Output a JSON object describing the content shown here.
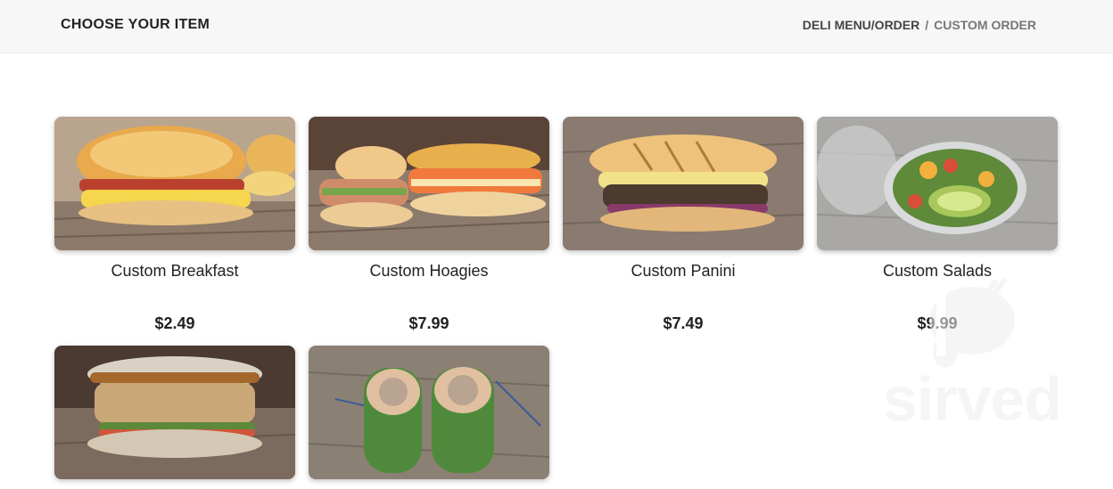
{
  "header": {
    "title": "CHOOSE YOUR ITEM",
    "breadcrumb": {
      "parent": "DELI MENU/ORDER",
      "separator": "/",
      "current": "CUSTOM ORDER"
    }
  },
  "items": [
    {
      "name": "Custom Breakfast",
      "price": "$2.49",
      "image": "breakfast-sandwich"
    },
    {
      "name": "Custom Hoagies",
      "price": "$7.99",
      "image": "hoagie"
    },
    {
      "name": "Custom Panini",
      "price": "$7.49",
      "image": "panini"
    },
    {
      "name": "Custom Salads",
      "price": "$9.99",
      "image": "salad"
    },
    {
      "name": "",
      "price": "",
      "image": "sandwich"
    },
    {
      "name": "",
      "price": "",
      "image": "wrap"
    }
  ],
  "watermark": {
    "text": "sirved"
  },
  "colors": {
    "topbar_bg": "#f7f7f7",
    "text": "#222222",
    "muted": "#777777"
  }
}
